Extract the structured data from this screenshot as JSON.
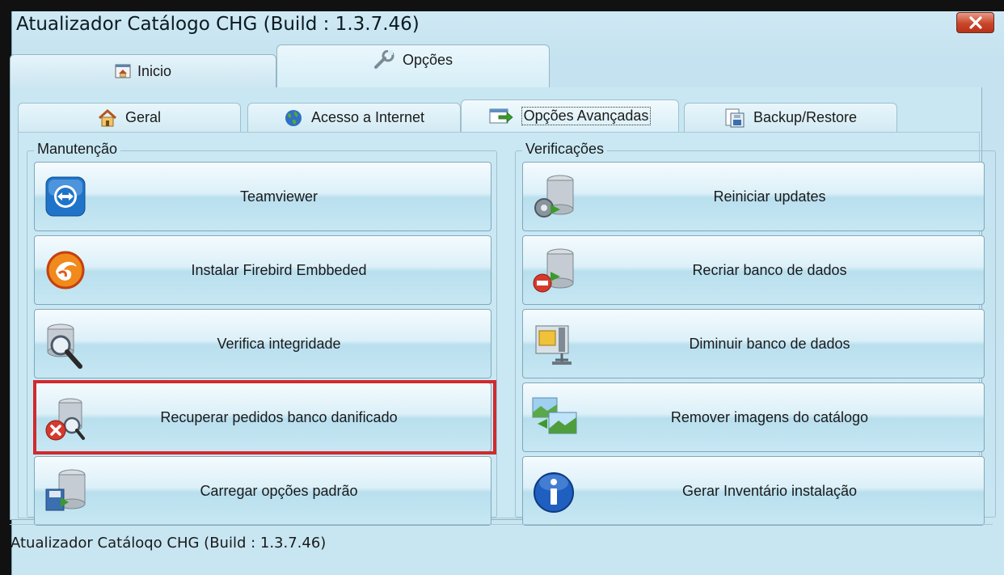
{
  "window": {
    "title": "Atualizador Catálogo CHG  (Build : 1.3.7.46)"
  },
  "main_tabs": [
    {
      "label": "Inicio",
      "icon": "home-window-icon"
    },
    {
      "label": "Opções",
      "icon": "wrench-icon"
    }
  ],
  "sub_tabs": [
    {
      "label": "Geral",
      "icon": "house-icon"
    },
    {
      "label": "Acesso a Internet",
      "icon": "globe-icon"
    },
    {
      "label": "Opções Avançadas",
      "icon": "arrow-window-icon"
    },
    {
      "label": "Backup/Restore",
      "icon": "backup-icon"
    }
  ],
  "groups": {
    "manutencao": {
      "title": "Manutenção",
      "buttons": [
        {
          "label": "Teamviewer",
          "icon": "teamviewer-icon"
        },
        {
          "label": "Instalar Firebird Embbeded",
          "icon": "firebird-icon"
        },
        {
          "label": "Verifica integridade",
          "icon": "database-search-icon"
        },
        {
          "label": "Recuperar pedidos banco danificado",
          "icon": "database-error-icon"
        },
        {
          "label": "Carregar opções padrão",
          "icon": "database-load-icon"
        }
      ]
    },
    "verificacoes": {
      "title": "Verificações",
      "buttons": [
        {
          "label": "Reiniciar updates",
          "icon": "database-gear-icon"
        },
        {
          "label": "Recriar banco de dados",
          "icon": "database-remove-icon"
        },
        {
          "label": "Diminuir banco de dados",
          "icon": "compress-icon"
        },
        {
          "label": "Remover imagens do catálogo",
          "icon": "images-icon"
        },
        {
          "label": "Gerar Inventário instalação",
          "icon": "info-icon"
        }
      ]
    }
  },
  "status_bar": {
    "text": "Atualizador Catáloqo CHG  (Build : 1.3.7.46)"
  },
  "colors": {
    "highlight": "#d02a2e",
    "close_button": "#c9462a",
    "window_bg": "#c8e6f2"
  }
}
